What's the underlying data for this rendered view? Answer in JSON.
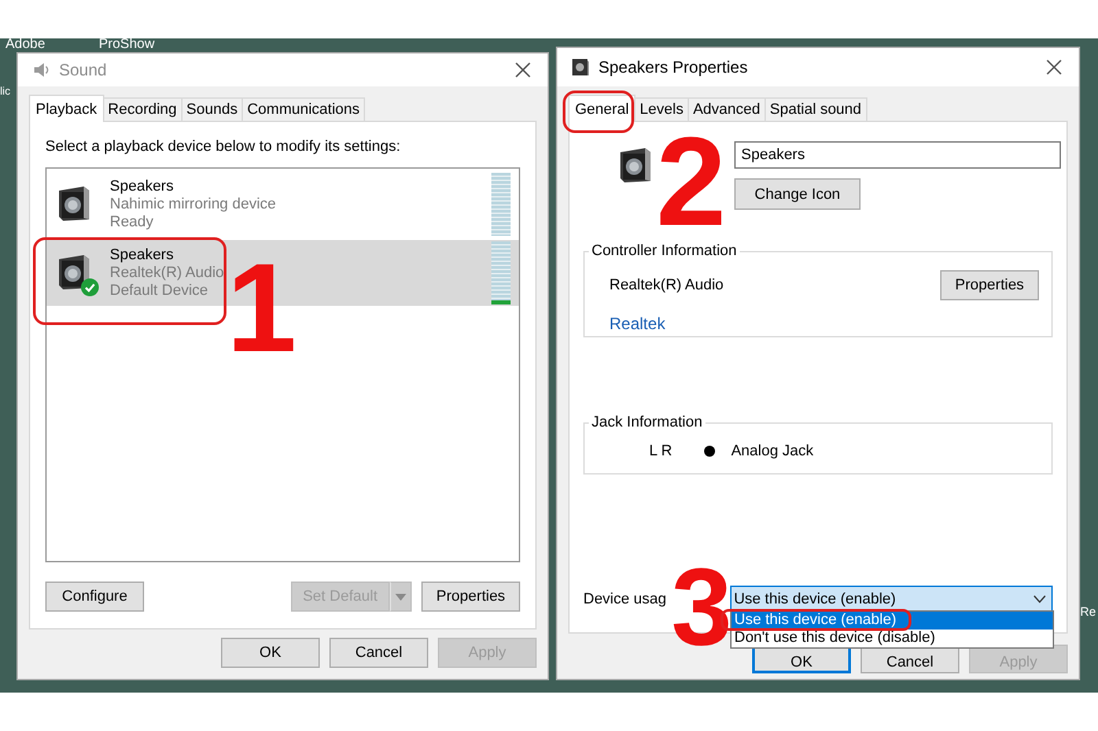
{
  "desktop": {
    "top_labels": [
      "Adobe",
      "ProShow"
    ],
    "left_label": "lic",
    "right_label": "Re"
  },
  "sound_dialog": {
    "title": "Sound",
    "tabs": [
      {
        "label": "Playback",
        "selected": true
      },
      {
        "label": "Recording",
        "selected": false
      },
      {
        "label": "Sounds",
        "selected": false
      },
      {
        "label": "Communications",
        "selected": false
      }
    ],
    "instruction": "Select a playback device below to modify its settings:",
    "devices": [
      {
        "name": "Speakers",
        "description": "Nahimic mirroring device",
        "status": "Ready",
        "selected": false,
        "default": false,
        "level": 0
      },
      {
        "name": "Speakers",
        "description": "Realtek(R) Audio",
        "status": "Default Device",
        "selected": true,
        "default": true,
        "level": 0.06
      }
    ],
    "buttons": [
      {
        "label": "Configure",
        "kind": "plain",
        "disabled": false
      },
      {
        "label": "Set Default",
        "kind": "split",
        "disabled": true
      },
      {
        "label": "Properties",
        "kind": "plain",
        "disabled": false
      }
    ],
    "footer_buttons": [
      {
        "label": "OK",
        "default": false,
        "disabled": false
      },
      {
        "label": "Cancel",
        "default": false,
        "disabled": false
      },
      {
        "label": "Apply",
        "default": false,
        "disabled": true
      }
    ],
    "annotation": "1"
  },
  "properties_dialog": {
    "title": "Speakers Properties",
    "tabs": [
      {
        "label": "General",
        "selected": true
      },
      {
        "label": "Levels",
        "selected": false
      },
      {
        "label": "Advanced",
        "selected": false
      },
      {
        "label": "Spatial sound",
        "selected": false
      }
    ],
    "name_field": {
      "value": "Speakers"
    },
    "change_icon_button": "Change Icon",
    "controller_information": {
      "heading": "Controller Information",
      "controller": "Realtek(R) Audio",
      "properties_button": "Properties",
      "link": "Realtek"
    },
    "jack_information": {
      "heading": "Jack Information",
      "channels": "L R",
      "jack": "Analog Jack"
    },
    "device_usage": {
      "label": "Device usag",
      "value": "Use this device (enable)",
      "expanded": true,
      "options": [
        {
          "label": "Use this device (enable)",
          "selected": true
        },
        {
          "label": "Don't use this device (disable)",
          "selected": false
        }
      ]
    },
    "footer_buttons": [
      {
        "label": "OK",
        "default": true,
        "disabled": false
      },
      {
        "label": "Cancel",
        "default": false,
        "disabled": false
      },
      {
        "label": "Apply",
        "default": false,
        "disabled": true
      }
    ],
    "annotations": [
      "2",
      "3"
    ]
  }
}
